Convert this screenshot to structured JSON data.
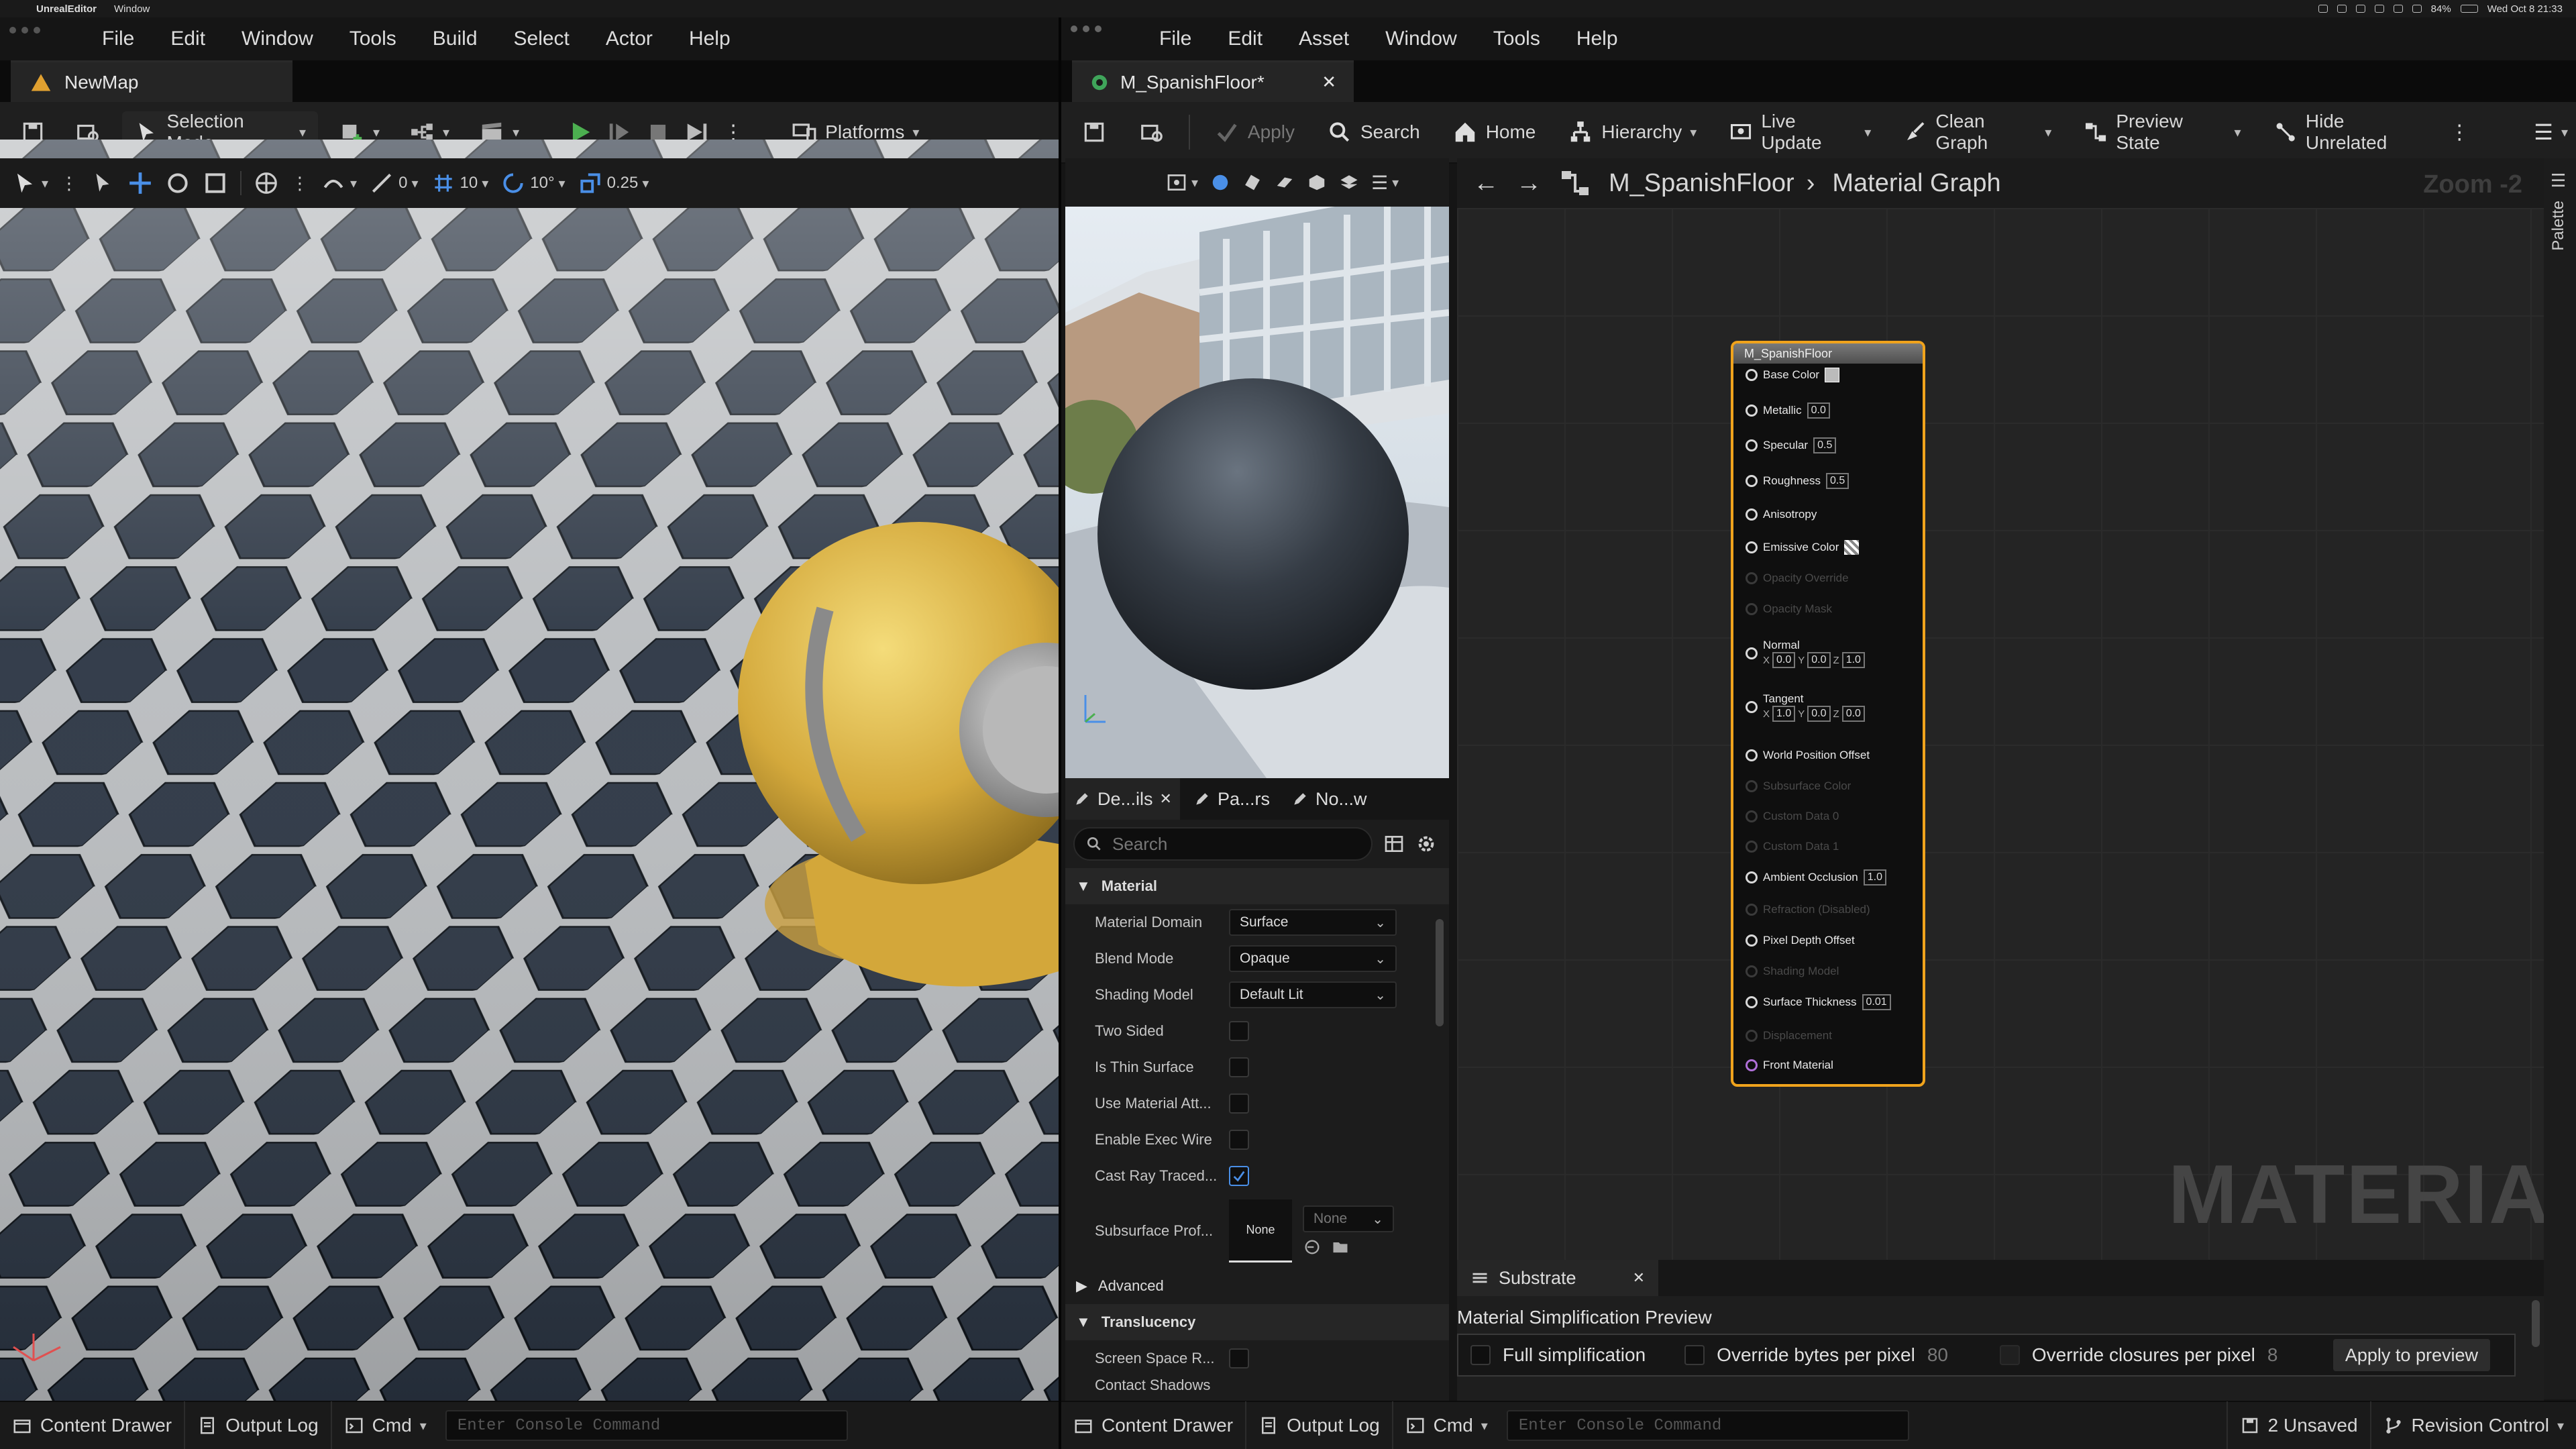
{
  "macbar": {
    "app": "UnrealEditor",
    "menu": "Window",
    "clock": "Wed Oct 8 21:33",
    "battery": "84%"
  },
  "left": {
    "menu": [
      "File",
      "Edit",
      "Window",
      "Tools",
      "Build",
      "Select",
      "Actor",
      "Help"
    ],
    "tab": "NewMap",
    "toolbar": {
      "selection_mode": "Selection Mode",
      "platforms": "Platforms"
    },
    "viewport_bar": {
      "rotation_snap": "0",
      "grid": "10",
      "angle": "10°",
      "scale": "0.25"
    },
    "bottom": {
      "content_drawer": "Content Drawer",
      "output_log": "Output Log",
      "cmd": "Cmd",
      "console_placeholder": "Enter Console Command"
    }
  },
  "right": {
    "menu": [
      "File",
      "Edit",
      "Asset",
      "Window",
      "Tools",
      "Help"
    ],
    "tab": "M_SpanishFloor*",
    "toolbar": {
      "apply": "Apply",
      "search": "Search",
      "home": "Home",
      "hierarchy": "Hierarchy",
      "live_update": "Live Update",
      "clean_graph": "Clean Graph",
      "preview_state": "Preview State",
      "hide_unrelated": "Hide Unrelated"
    },
    "graph": {
      "breadcrumb_asset": "M_SpanishFloor",
      "breadcrumb_graph": "Material Graph",
      "zoom": "Zoom -2",
      "watermark": "MATERIAL",
      "palette": "Palette"
    },
    "panel_tabs": [
      "De...ils",
      "Pa...rs",
      "No...w"
    ],
    "details": {
      "search_placeholder": "Search",
      "category_material": "Material",
      "rows": [
        {
          "label": "Material Domain",
          "value": "Surface"
        },
        {
          "label": "Blend Mode",
          "value": "Opaque"
        },
        {
          "label": "Shading Model",
          "value": "Default Lit"
        }
      ],
      "checks": [
        {
          "label": "Two Sided",
          "checked": false
        },
        {
          "label": "Is Thin Surface",
          "checked": false
        },
        {
          "label": "Use Material Att...",
          "checked": false
        },
        {
          "label": "Enable Exec Wire",
          "checked": false
        },
        {
          "label": "Cast Ray Traced...",
          "checked": true
        }
      ],
      "subsurface_label": "Subsurface Prof...",
      "subsurface_thumb": "None",
      "subsurface_dd": "None",
      "category_advanced": "Advanced",
      "category_translucency": "Translucency",
      "screen_space": "Screen Space R...",
      "contact_shadows": "Contact Shadows"
    },
    "node": {
      "title": "M_SpanishFloor",
      "pins": {
        "base_color": "Base Color",
        "metallic": "Metallic",
        "metallic_v": "0.0",
        "specular": "Specular",
        "specular_v": "0.5",
        "roughness": "Roughness",
        "roughness_v": "0.5",
        "anisotropy": "Anisotropy",
        "emissive": "Emissive Color",
        "opacity_override": "Opacity Override",
        "opacity_mask": "Opacity Mask",
        "normal": "Normal",
        "normal_x": "0.0",
        "normal_y": "0.0",
        "normal_z": "1.0",
        "tangent": "Tangent",
        "tangent_x": "1.0",
        "tangent_y": "0.0",
        "tangent_z": "0.0",
        "wpo": "World Position Offset",
        "subsurface": "Subsurface Color",
        "custom0": "Custom Data 0",
        "custom1": "Custom Data 1",
        "ao": "Ambient Occlusion",
        "ao_v": "1.0",
        "refraction": "Refraction (Disabled)",
        "pdo": "Pixel Depth Offset",
        "shading_model": "Shading Model",
        "thickness": "Surface Thickness",
        "thickness_v": "0.01",
        "displacement": "Displacement",
        "front": "Front Material"
      }
    },
    "substrate": {
      "tab": "Substrate",
      "heading": "Material Simplification Preview",
      "full": "Full simplification",
      "override_bytes": "Override bytes per pixel",
      "bytes_v": "80",
      "override_closures": "Override closures per pixel",
      "closures_v": "8",
      "apply_preview": "Apply to preview"
    },
    "bottom": {
      "content_drawer": "Content Drawer",
      "output_log": "Output Log",
      "cmd": "Cmd",
      "console_placeholder": "Enter Console Command",
      "unsaved": "2 Unsaved",
      "revision": "Revision Control"
    }
  }
}
